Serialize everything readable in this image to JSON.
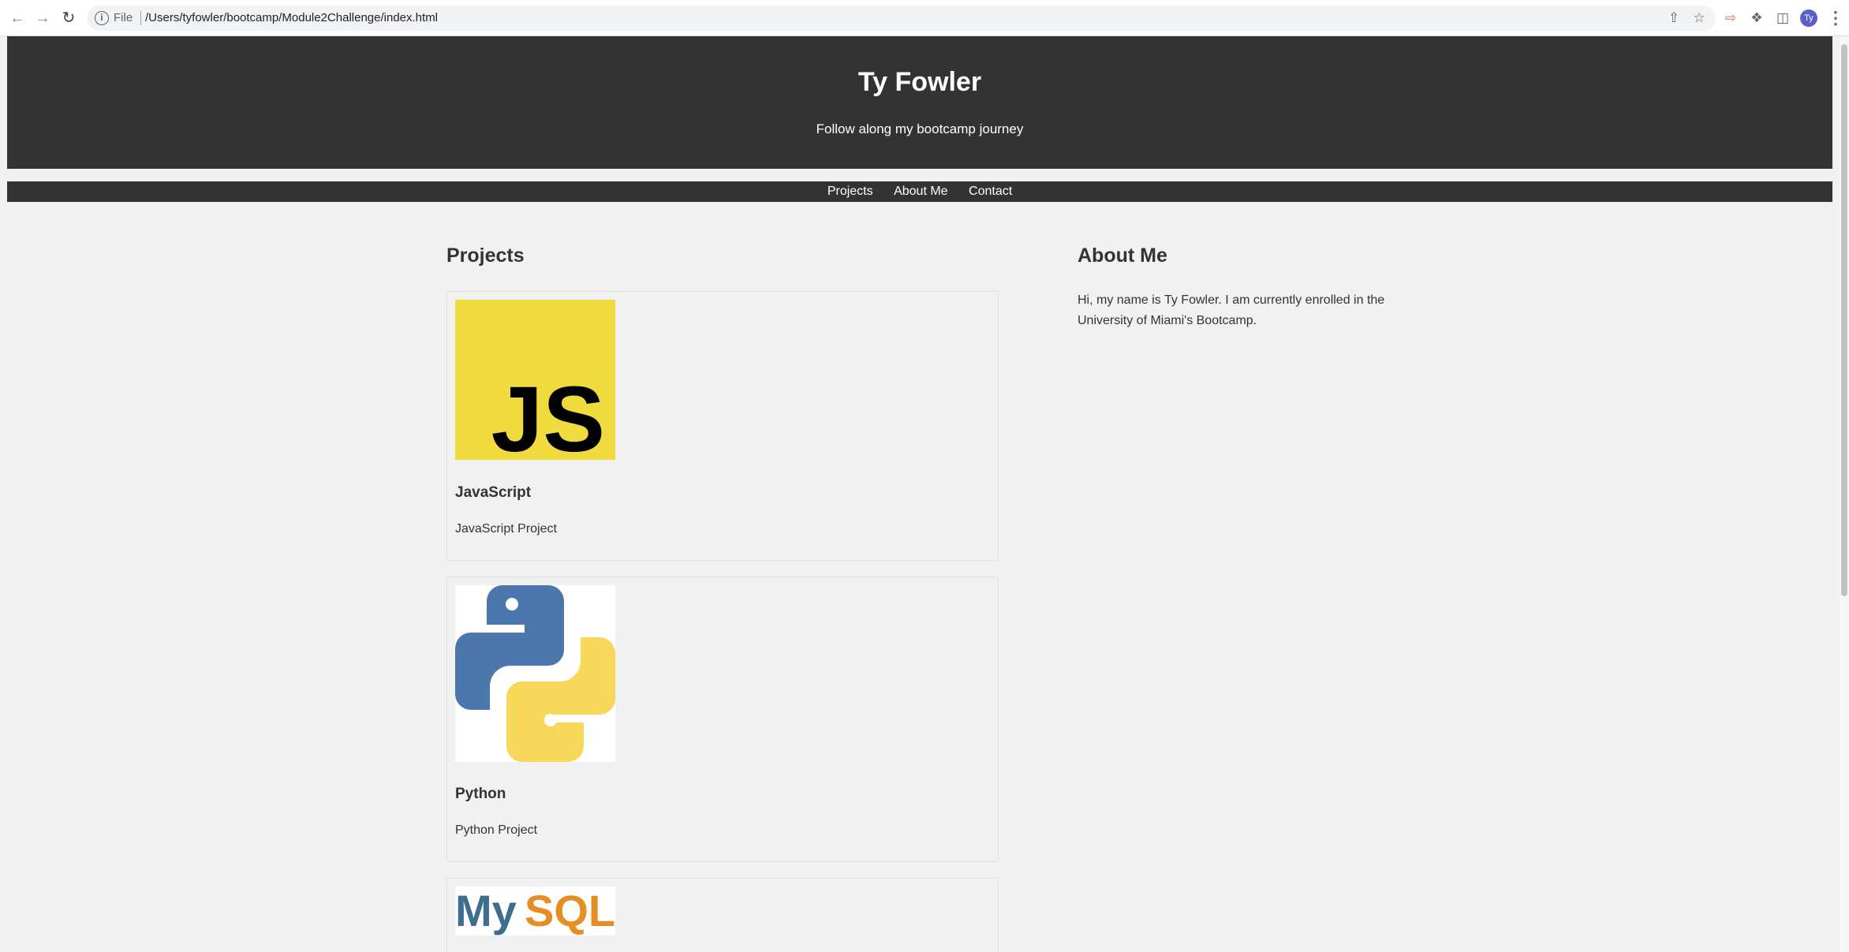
{
  "browser": {
    "omnibox": {
      "scheme_label": "File",
      "url": "/Users/tyfowler/bootcamp/Module2Challenge/index.html"
    },
    "profile_initials": "Ty"
  },
  "header": {
    "title": "Ty Fowler",
    "tagline": "Follow along my bootcamp journey"
  },
  "nav": {
    "items": [
      {
        "label": "Projects"
      },
      {
        "label": "About Me"
      },
      {
        "label": "Contact"
      }
    ]
  },
  "projects": {
    "heading": "Projects",
    "items": [
      {
        "title": "JavaScript",
        "description": "JavaScript Project",
        "logo_text": "JS",
        "logo_bg": "#f0db3e"
      },
      {
        "title": "Python",
        "description": "Python Project",
        "logo_colors": [
          "#4b77ad",
          "#f7d75a"
        ]
      },
      {
        "logo_text_my": "My",
        "logo_text_sql": "SQL",
        "logo_colors": [
          "#3e6e8e",
          "#e48e23"
        ]
      }
    ]
  },
  "about": {
    "heading": "About Me",
    "text": "Hi, my name is Ty Fowler. I am currently enrolled in the University of Miami's Bootcamp."
  },
  "colors": {
    "header_bg": "#333333",
    "page_bg": "#f1f1f1"
  }
}
